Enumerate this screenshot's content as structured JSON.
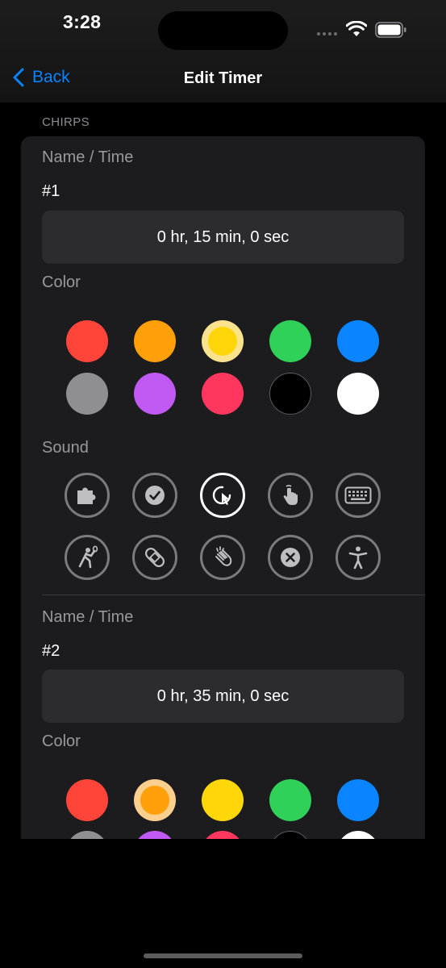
{
  "status": {
    "time": "3:28"
  },
  "nav": {
    "back_label": "Back",
    "title": "Edit Timer"
  },
  "section_header": "CHIRPS",
  "timers": [
    {
      "name_label": "Name / Time",
      "name": "#1",
      "duration": "0 hr, 15 min, 0 sec",
      "color_label": "Color",
      "sound_label": "Sound",
      "selected_color": "yellow",
      "selected_sound": "cursor-click"
    },
    {
      "name_label": "Name / Time",
      "name": "#2",
      "duration": "0 hr, 35 min, 0 sec",
      "color_label": "Color",
      "selected_color": "orange"
    }
  ],
  "colors": {
    "red": "#ff453a",
    "orange": "#ff9f0a",
    "yellow": "#ffd60a",
    "green": "#30d158",
    "blue": "#0a84ff",
    "gray": "#8e8e93",
    "purple": "#bf5af2",
    "pink": "#ff375f",
    "black": "#000000",
    "white": "#ffffff",
    "accent": "#0a84ff"
  },
  "sound_icons": [
    "puzzle-icon",
    "checkmark-circle-icon",
    "cursor-click-icon",
    "hand-tap-icon",
    "keyboard-icon",
    "figure-tennis-icon",
    "bandage-icon",
    "hands-clap-icon",
    "xmark-circle-icon",
    "accessibility-icon"
  ]
}
